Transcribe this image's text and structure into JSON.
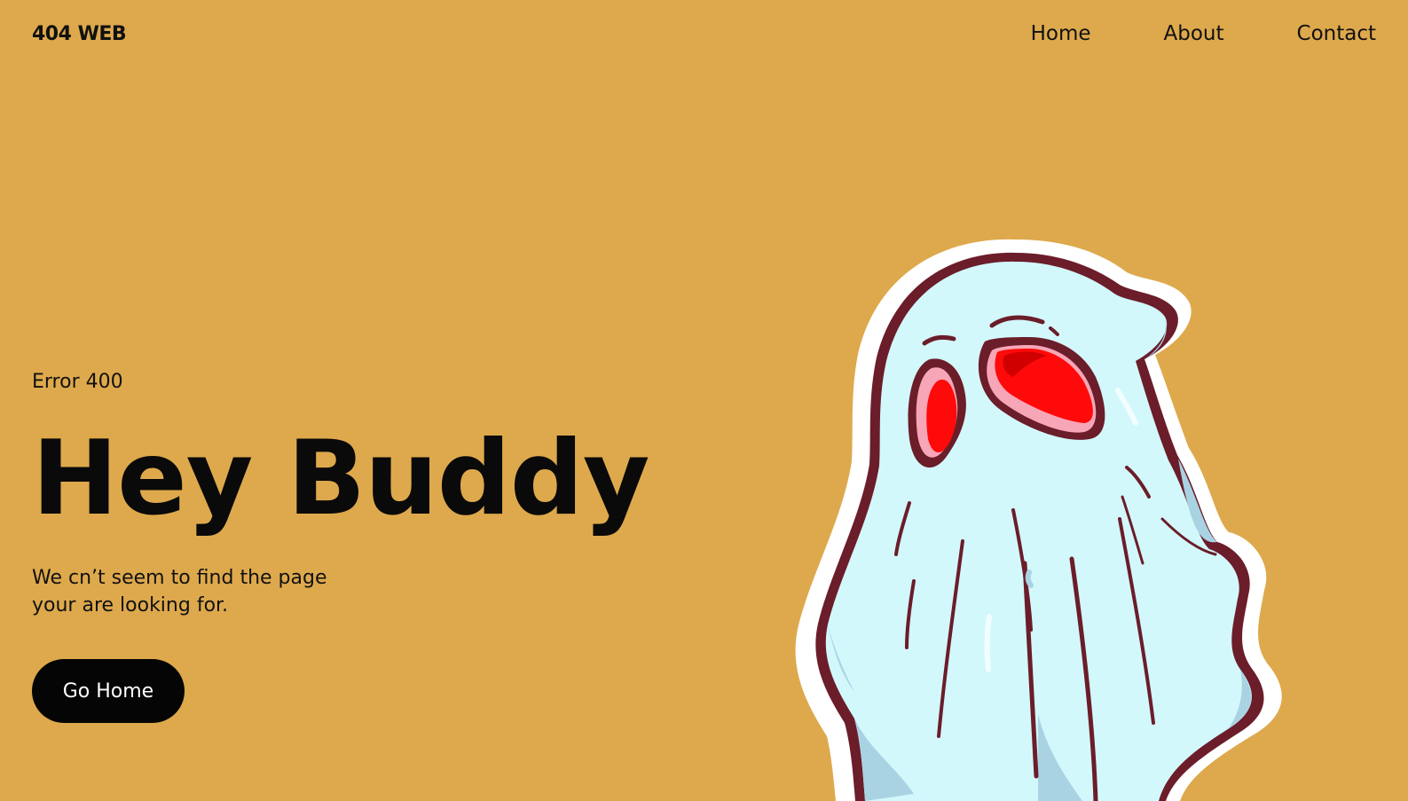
{
  "header": {
    "logo": "404 WEB",
    "nav": [
      {
        "label": "Home"
      },
      {
        "label": "About"
      },
      {
        "label": "Contact"
      }
    ]
  },
  "hero": {
    "eyebrow": "Error 400",
    "headline": "Hey Buddy",
    "description_line1": "We cn’t seem to find the page",
    "description_line2": "your are looking for.",
    "cta_label": "Go Home"
  },
  "illustration": {
    "name": "ghost-illustration"
  },
  "colors": {
    "background": "#DEA94C",
    "text": "#0B0B0B",
    "button": "#050505",
    "button_text": "#FFFFFF",
    "ghost_body": "#D2F8FB",
    "ghost_outline": "#6B1D2A",
    "ghost_eye": "#FF0A0A"
  }
}
